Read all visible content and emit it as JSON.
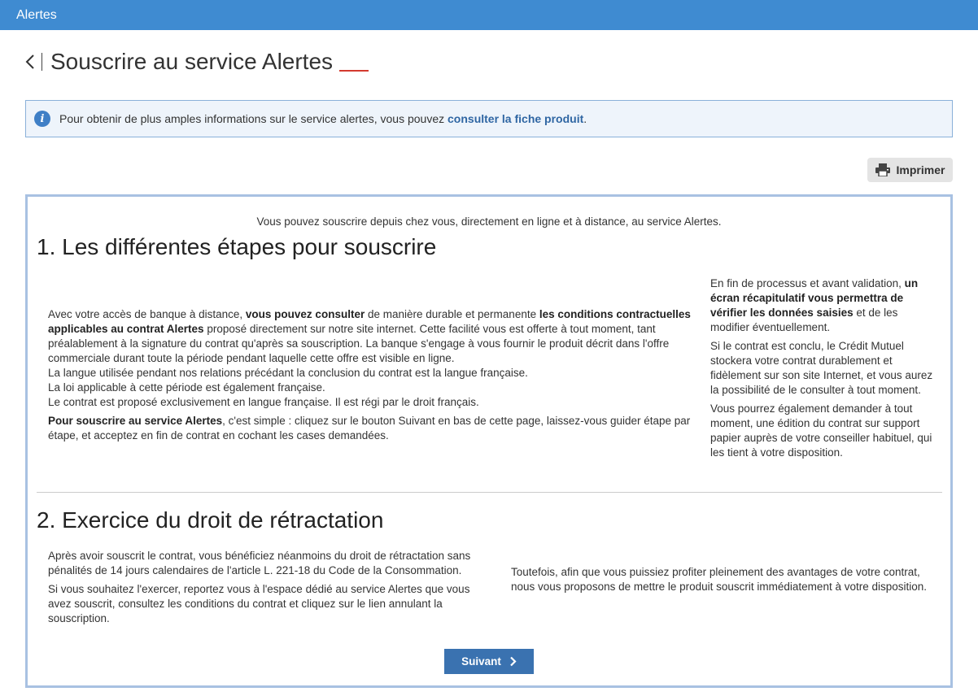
{
  "topbar": {
    "title": "Alertes"
  },
  "header": {
    "page_title": "Souscrire au service Alertes"
  },
  "info": {
    "text": "Pour obtenir de plus amples informations sur le service alertes, vous pouvez ",
    "link": "consulter la fiche produit",
    "suffix": ".",
    "icon": "info-icon"
  },
  "toolbar": {
    "print_label": "Imprimer",
    "print_icon": "printer-icon"
  },
  "content": {
    "intro": "Vous pouvez souscrire depuis chez vous, directement en ligne et à distance, au service Alertes.",
    "section1": {
      "title": "1. Les différentes étapes pour souscrire",
      "left": {
        "p1_a": "Avec votre accès de banque à distance, ",
        "p1_b": "vous pouvez consulter",
        "p1_c": " de manière durable et permanente ",
        "p1_d": "les conditions contractuelles applicables au contrat Alertes",
        "p1_e": " proposé directement sur notre site internet. Cette facilité vous est offerte à tout moment, tant préalablement à la signature du contrat qu'après sa souscription. La banque s'engage à vous fournir le produit décrit dans l'offre commerciale durant toute la période pendant laquelle cette offre est visible en ligne.",
        "l2": "La langue utilisée pendant nos relations précédant la conclusion du contrat est la langue française.",
        "l3": "La loi applicable à cette période est également française.",
        "l4": "Le contrat est proposé exclusivement en langue française. Il est régi par le droit français.",
        "p2_a": "Pour souscrire au service Alertes",
        "p2_b": ", c'est simple : cliquez sur le bouton Suivant en bas de cette page, laissez-vous guider étape par étape, et acceptez en fin de contrat en cochant les cases demandées."
      },
      "right": {
        "p1_a": "En fin de processus et avant validation, ",
        "p1_b": "un écran récapitulatif vous permettra de vérifier les données saisies",
        "p1_c": " et de les modifier éventuellement.",
        "p2": "Si le contrat est conclu, le Crédit Mutuel stockera votre contrat durablement et fidèlement sur son site Internet, et vous aurez la possibilité de le consulter à tout moment.",
        "p3": "Vous pourrez également demander à tout moment, une édition du contrat sur support papier auprès de votre conseiller habituel, qui les tient à votre disposition."
      }
    },
    "section2": {
      "title": "2. Exercice du droit de rétractation",
      "left_p1": "Après avoir souscrit le contrat, vous bénéficiez néanmoins du droit de rétractation sans pénalités de 14 jours calendaires de l'article L. 221-18 du Code de la Consommation.",
      "left_p2": "Si vous souhaitez l'exercer, reportez vous à l'espace dédié au service Alertes que vous avez souscrit, consultez les conditions du contrat et cliquez sur le lien annulant la souscription.",
      "right_p1": "Toutefois, afin que vous puissiez profiter pleinement des avantages de votre contrat, nous vous proposons de mettre le produit souscrit immédiatement à votre disposition."
    },
    "next_label": "Suivant"
  },
  "colors": {
    "topbar": "#3f8bd1",
    "accent": "#d43a2f",
    "button": "#3a72b0",
    "border": "#a8c1e2"
  }
}
